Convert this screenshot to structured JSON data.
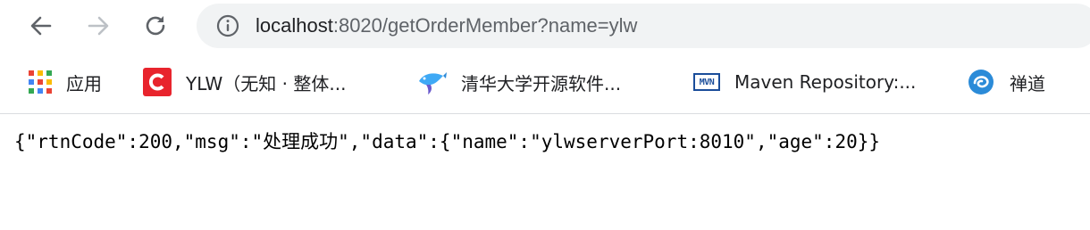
{
  "browser": {
    "url_host": "localhost",
    "url_rest": ":8020/getOrderMember?name=ylw",
    "icons": {
      "back": "back-arrow-icon",
      "forward": "forward-arrow-icon",
      "reload": "reload-icon",
      "site_info": "info-icon"
    }
  },
  "bookmarks": [
    {
      "label": "应用",
      "icon": "apps-grid-icon"
    },
    {
      "label": "YLW（无知 · 整体...",
      "icon": "ylw-c-logo-icon"
    },
    {
      "label": "清华大学开源软件...",
      "icon": "tuna-fish-icon"
    },
    {
      "label": "Maven Repository:...",
      "icon": "mvn-icon",
      "icon_text": "MVN"
    },
    {
      "label": "禅道",
      "icon": "zentao-swirl-icon"
    }
  ],
  "page": {
    "body_text": "{\"rtnCode\":200,\"msg\":\"处理成功\",\"data\":{\"name\":\"ylwserverPort:8010\",\"age\":20}}"
  },
  "colors": {
    "omnibox_bg": "#f1f3f4",
    "url_host": "#202124",
    "url_rest": "#5f6368",
    "ylw_red": "#e8242d",
    "maven_blue": "#1a4d9a",
    "zentao_blue": "#2b8bd8"
  }
}
